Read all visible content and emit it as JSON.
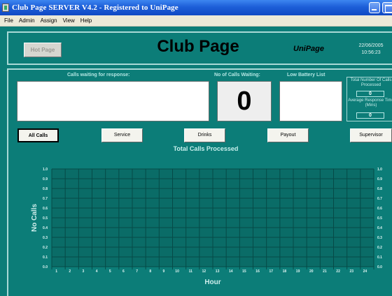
{
  "window": {
    "title": "Club Page SERVER V4.2 - Registered to UniPage"
  },
  "menu": [
    "File",
    "Admin",
    "Assign",
    "View",
    "Help"
  ],
  "header": {
    "hot_page_label": "Hot Page",
    "title": "Club Page",
    "brand": "UniPage",
    "date": "22/06/2005",
    "time": "10:56:23"
  },
  "calls": {
    "waiting_label": "Calls waiting for response:",
    "count_label": "No of Calls Waiting:",
    "count_value": "0",
    "battery_label": "Low Battery List"
  },
  "stats": {
    "total_label": "Total Number Of Calls Processed",
    "total_value": "0",
    "avg_label": "Average Response Time (Mins)",
    "avg_value": "0"
  },
  "buttons": [
    "All Calls",
    "Service",
    "Drinks",
    "Payout",
    "Supervisor"
  ],
  "colors": {
    "background": "#0c7d78",
    "grid": "#064a47",
    "titlebar": "#1d5fd8"
  },
  "chart_data": {
    "type": "bar",
    "title": "Total Calls Processed",
    "xlabel": "Hour",
    "ylabel": "No Calls",
    "categories": [
      "1",
      "2",
      "3",
      "4",
      "5",
      "6",
      "7",
      "8",
      "9",
      "10",
      "11",
      "12",
      "13",
      "14",
      "15",
      "16",
      "17",
      "18",
      "19",
      "20",
      "21",
      "22",
      "23",
      "24"
    ],
    "values": [
      0,
      0,
      0,
      0,
      0,
      0,
      0,
      0,
      0,
      0,
      0,
      0,
      0,
      0,
      0,
      0,
      0,
      0,
      0,
      0,
      0,
      0,
      0,
      0
    ],
    "y_ticks": [
      "0.0",
      "0.1",
      "0.2",
      "0.3",
      "0.4",
      "0.5",
      "0.6",
      "0.7",
      "0.8",
      "0.9",
      "1.0"
    ],
    "ylim": [
      0,
      1.0
    ],
    "grid": true
  }
}
